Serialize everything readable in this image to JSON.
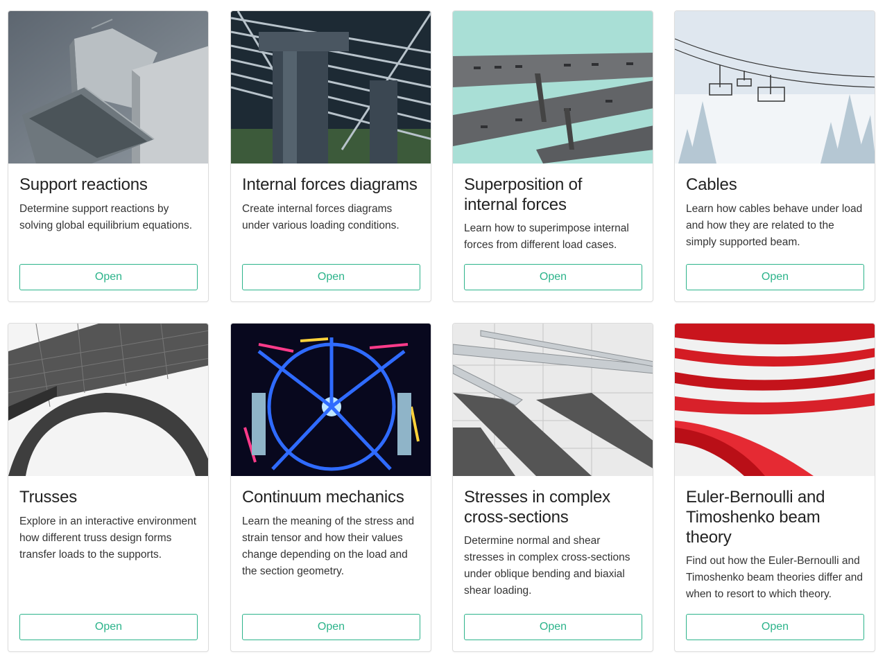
{
  "cards": [
    {
      "title": "Support reactions",
      "description": "Determine support reactions by solving global equilibrium equations.",
      "button_label": "Open",
      "image": "building-overhang-photo"
    },
    {
      "title": "Internal forces diagrams",
      "description": "Create internal forces diagrams under various loading conditions.",
      "button_label": "Open",
      "image": "steel-pergola-photo"
    },
    {
      "title": "Superposition of internal forces",
      "description": "Learn how to superimpose internal forces from different load cases.",
      "button_label": "Open",
      "image": "bridges-sky-photo"
    },
    {
      "title": "Cables",
      "description": "Learn how cables behave under load and how they are related to the simply supported beam.",
      "button_label": "Open",
      "image": "ski-lift-photo"
    },
    {
      "title": "Trusses",
      "description": "Explore in an interactive environment how different truss design forms transfer loads to the supports.",
      "button_label": "Open",
      "image": "eiffel-tower-photo"
    },
    {
      "title": "Continuum mechanics",
      "description": "Learn the meaning of the stress and strain tensor and how their values change depending on the load and the section geometry.",
      "button_label": "Open",
      "image": "neon-sphere-photo"
    },
    {
      "title": "Stresses in complex cross-sections",
      "description": "Determine normal and shear stresses in complex cross-sections under oblique bending and biaxial shear loading.",
      "button_label": "Open",
      "image": "facade-shadows-photo"
    },
    {
      "title": "Euler-Bernoulli and Timoshenko beam theory",
      "description": "Find out how the Euler-Bernoulli and Timoshenko beam theories differ and when to resort to which theory.",
      "button_label": "Open",
      "image": "red-stripes-building-photo"
    }
  ],
  "colors": {
    "accent": "#2bb38a",
    "card_border": "#dcdcdc",
    "title_text": "#222222",
    "body_text": "#333333"
  }
}
